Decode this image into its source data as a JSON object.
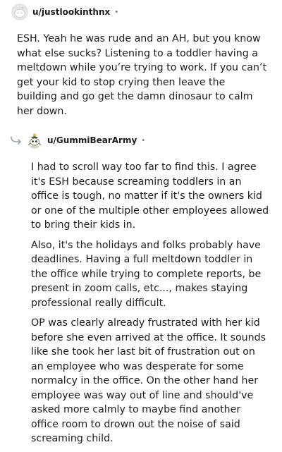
{
  "comment1": {
    "username": "u/justlookinthnx",
    "separator": "•",
    "avatar_icon": "default-snoo-avatar-icon",
    "body": "ESH. Yeah he was rude and an AH, but you know what else sucks? Listening to a toddler having a meltdown while you’re trying to work. If you can’t get your kid to stop crying then leave the building and go get the damn dinosaur to calm her down."
  },
  "comment2": {
    "username": "u/GummiBearArmy",
    "separator": "•",
    "avatar_icon": "custom-snoo-avatar-icon",
    "reply_icon": "reply-thread-arrow-icon",
    "paragraphs": [
      "I had to scroll way too far to find this. I agree it's ESH because screaming toddlers in an office is tough, no matter if it's the owners kid or one of the multiple other employees allowed to bring their kids in.",
      "Also, it's the holidays and folks probably have deadlines. Having a full meltdown toddler in the office while trying to complete reports, be present in zoom calls, etc..., makes staying professional really difficult.",
      "OP was clearly already frustrated with her kid before she even arrived at the office. It sounds like she took her last bit of frustration out on an employee who was desperate for some normalcy in the office. On the other hand her employee was way out of line and should've asked more calmly to maybe find another office room to drown out the noise of said screaming child."
    ]
  }
}
